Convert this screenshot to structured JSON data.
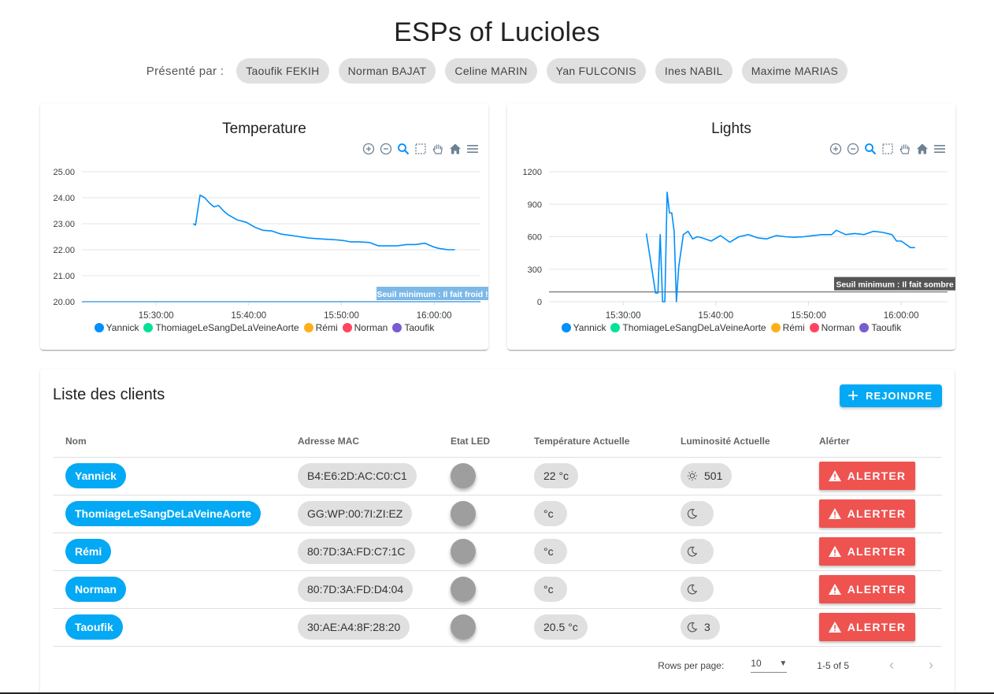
{
  "header": {
    "title": "ESPs of Lucioles",
    "presented_by_label": "Présenté par :",
    "presenters": [
      "Taoufik FEKIH",
      "Norman BAJAT",
      "Celine MARIN",
      "Yan FULCONIS",
      "Ines NABIL",
      "Maxime MARIAS"
    ]
  },
  "chart_toolbar_icons": [
    "zoom-in-icon",
    "zoom-out-icon",
    "zoom-selection-icon",
    "selection-icon",
    "pan-hand-icon",
    "home-icon",
    "menu-icon"
  ],
  "chart_data": [
    {
      "type": "line",
      "title": "Temperature",
      "x_ticks": [
        "15:30:00",
        "15:40:00",
        "15:50:00",
        "16:00:00"
      ],
      "y_ticks": [
        "25.00",
        "24.00",
        "23.00",
        "22.00",
        "21.00",
        "20.00"
      ],
      "ylim": [
        20,
        25
      ],
      "xlim": [
        "15:22:00",
        "16:05:00"
      ],
      "grid": true,
      "legend_position": "bottom",
      "annotation": {
        "label": "Seuil minimum : Il fait froid !",
        "y": 20,
        "color": "#7cb9e8"
      },
      "series": [
        {
          "name": "Yannick",
          "color": "#008ffb",
          "x": [
            "15:34:00",
            "15:34:15",
            "15:34:45",
            "15:35:15",
            "15:35:45",
            "15:36:15",
            "15:36:45",
            "15:37:15",
            "15:37:45",
            "15:38:15",
            "15:38:45",
            "15:39:15",
            "15:39:45",
            "15:40:15",
            "15:40:45",
            "15:41:30",
            "15:42:30",
            "15:43:30",
            "15:44:30",
            "15:45:30",
            "15:46:30",
            "15:47:30",
            "15:48:30",
            "15:49:30",
            "15:50:15",
            "15:51:00",
            "15:52:00",
            "15:53:00",
            "15:54:00",
            "15:55:00",
            "15:56:00",
            "15:57:00",
            "15:58:00",
            "15:59:00",
            "16:00:00",
            "16:00:30",
            "16:01:30",
            "16:02:15"
          ],
          "y": [
            23.0,
            22.95,
            24.1,
            24.0,
            23.8,
            23.65,
            23.7,
            23.5,
            23.35,
            23.25,
            23.15,
            23.1,
            23.05,
            22.95,
            22.85,
            22.75,
            22.72,
            22.6,
            22.55,
            22.5,
            22.45,
            22.42,
            22.4,
            22.38,
            22.35,
            22.3,
            22.3,
            22.28,
            22.15,
            22.15,
            22.15,
            22.2,
            22.2,
            22.25,
            22.1,
            22.05,
            22.0,
            22.0
          ]
        },
        {
          "name": "ThomiageLeSangDeLaVeineAorte",
          "color": "#00e396",
          "x": [],
          "y": []
        },
        {
          "name": "Rémi",
          "color": "#feb019",
          "x": [],
          "y": []
        },
        {
          "name": "Norman",
          "color": "#ff4560",
          "x": [],
          "y": []
        },
        {
          "name": "Taoufik",
          "color": "#775dd0",
          "x": [],
          "y": []
        }
      ]
    },
    {
      "type": "line",
      "title": "Lights",
      "x_ticks": [
        "15:30:00",
        "15:40:00",
        "15:50:00",
        "16:00:00"
      ],
      "y_ticks": [
        "1200",
        "900",
        "600",
        "300",
        "0"
      ],
      "ylim": [
        0,
        1200
      ],
      "xlim": [
        "15:22:00",
        "16:05:00"
      ],
      "grid": true,
      "legend_position": "bottom",
      "annotation": {
        "label": "Seuil minimum : Il fait sombre",
        "y": 90,
        "color": "#555555"
      },
      "series": [
        {
          "name": "Yannick",
          "color": "#008ffb",
          "x": [
            "15:32:30",
            "15:33:30",
            "15:33:45",
            "15:34:00",
            "15:34:15",
            "15:34:30",
            "15:34:45",
            "15:35:00",
            "15:35:15",
            "15:35:30",
            "15:35:45",
            "15:36:00",
            "15:36:30",
            "15:37:00",
            "15:37:30",
            "15:38:00",
            "15:38:30",
            "15:39:30",
            "15:40:30",
            "15:41:30",
            "15:42:30",
            "15:43:30",
            "15:44:30",
            "15:45:30",
            "15:46:30",
            "15:47:30",
            "15:48:30",
            "15:49:30",
            "15:50:30",
            "15:51:30",
            "15:52:30",
            "15:53:00",
            "15:54:00",
            "15:55:00",
            "15:56:00",
            "15:57:00",
            "15:58:00",
            "15:59:00",
            "15:59:30",
            "16:00:00",
            "16:00:30",
            "16:01:00",
            "16:01:30"
          ],
          "y": [
            630,
            80,
            80,
            620,
            0,
            0,
            1010,
            820,
            820,
            650,
            0,
            320,
            620,
            650,
            580,
            600,
            590,
            560,
            610,
            550,
            600,
            620,
            590,
            580,
            610,
            600,
            595,
            600,
            610,
            620,
            620,
            660,
            620,
            630,
            620,
            650,
            640,
            620,
            560,
            560,
            530,
            500,
            500
          ]
        },
        {
          "name": "ThomiageLeSangDeLaVeineAorte",
          "color": "#00e396",
          "x": [],
          "y": []
        },
        {
          "name": "Rémi",
          "color": "#feb019",
          "x": [],
          "y": []
        },
        {
          "name": "Norman",
          "color": "#ff4560",
          "x": [],
          "y": []
        },
        {
          "name": "Taoufik",
          "color": "#775dd0",
          "x": [],
          "y": []
        }
      ]
    }
  ],
  "clients": {
    "title": "Liste des clients",
    "join_label": "REJOINDRE",
    "columns": [
      "Nom",
      "Adresse MAC",
      "Etat LED",
      "Température Actuelle",
      "Luminosité Actuelle",
      "Alérter"
    ],
    "rows": [
      {
        "name": "Yannick",
        "mac": "B4:E6:2D:AC:C0:C1",
        "temp": "22 °c",
        "lum": "501",
        "lum_icon": "sun-icon"
      },
      {
        "name": "ThomiageLeSangDeLaVeineAorte",
        "mac": "GG:WP:00:7I:ZI:EZ",
        "temp": "°c",
        "lum": "",
        "lum_icon": "moon-icon"
      },
      {
        "name": "Rémi",
        "mac": "80:7D:3A:FD:C7:1C",
        "temp": "°c",
        "lum": "",
        "lum_icon": "moon-icon"
      },
      {
        "name": "Norman",
        "mac": "80:7D:3A:FD:D4:04",
        "temp": "°c",
        "lum": "",
        "lum_icon": "moon-icon"
      },
      {
        "name": "Taoufik",
        "mac": "30:AE:A4:8F:28:20",
        "temp": "20.5 °c",
        "lum": "3",
        "lum_icon": "moon-icon"
      }
    ],
    "alert_label": "ALERTER",
    "rows_per_page_label": "Rows per page:",
    "rows_per_page_value": "10",
    "range_label": "1-5 of 5"
  },
  "colors": {
    "accent": "#03a9f4",
    "alert": "#ef5350",
    "led_off": "#9e9e9e",
    "chip": "#e0e0e0"
  }
}
